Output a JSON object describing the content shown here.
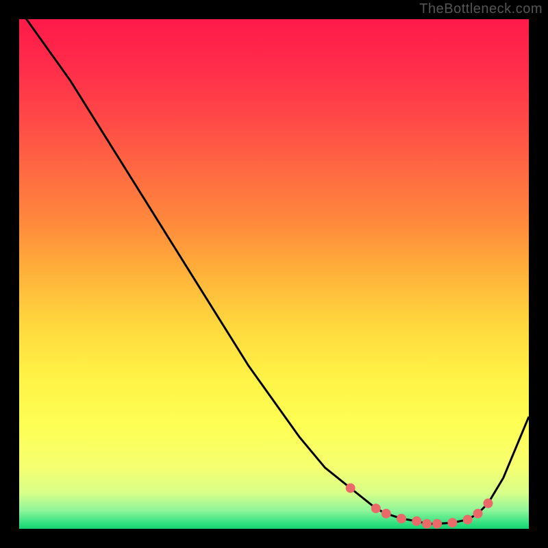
{
  "watermark": "TheBottleneck.com",
  "chart_data": {
    "type": "line",
    "title": "",
    "xlabel": "",
    "ylabel": "",
    "xlim": [
      0,
      100
    ],
    "ylim": [
      0,
      100
    ],
    "grid": false,
    "x": [
      0,
      5,
      10,
      15,
      20,
      25,
      30,
      35,
      40,
      45,
      50,
      55,
      60,
      65,
      70,
      72,
      75,
      78,
      80,
      82,
      85,
      88,
      90,
      92,
      95,
      100
    ],
    "y": [
      102,
      95,
      88,
      80,
      72,
      64,
      56,
      48,
      40,
      32,
      25,
      18,
      12,
      8,
      4,
      3,
      2,
      1.5,
      1,
      1,
      1.2,
      1.8,
      3,
      5,
      10,
      22
    ],
    "marker_indices": [
      13,
      14,
      15,
      16,
      17,
      18,
      19,
      20,
      21,
      22,
      23
    ],
    "marker_color": "#ea6a6a",
    "line_color": "#000000",
    "gradient_stops": [
      {
        "offset": 0.0,
        "color": "#ff1a4a"
      },
      {
        "offset": 0.1,
        "color": "#ff2e4a"
      },
      {
        "offset": 0.2,
        "color": "#ff4a47"
      },
      {
        "offset": 0.3,
        "color": "#ff6a42"
      },
      {
        "offset": 0.4,
        "color": "#ff8a3c"
      },
      {
        "offset": 0.5,
        "color": "#ffb23a"
      },
      {
        "offset": 0.6,
        "color": "#ffd83e"
      },
      {
        "offset": 0.7,
        "color": "#fff245"
      },
      {
        "offset": 0.8,
        "color": "#feff55"
      },
      {
        "offset": 0.88,
        "color": "#f5ff70"
      },
      {
        "offset": 0.93,
        "color": "#d8ff8a"
      },
      {
        "offset": 0.965,
        "color": "#8cf59a"
      },
      {
        "offset": 0.99,
        "color": "#2ee07f"
      },
      {
        "offset": 1.0,
        "color": "#15d070"
      }
    ]
  }
}
